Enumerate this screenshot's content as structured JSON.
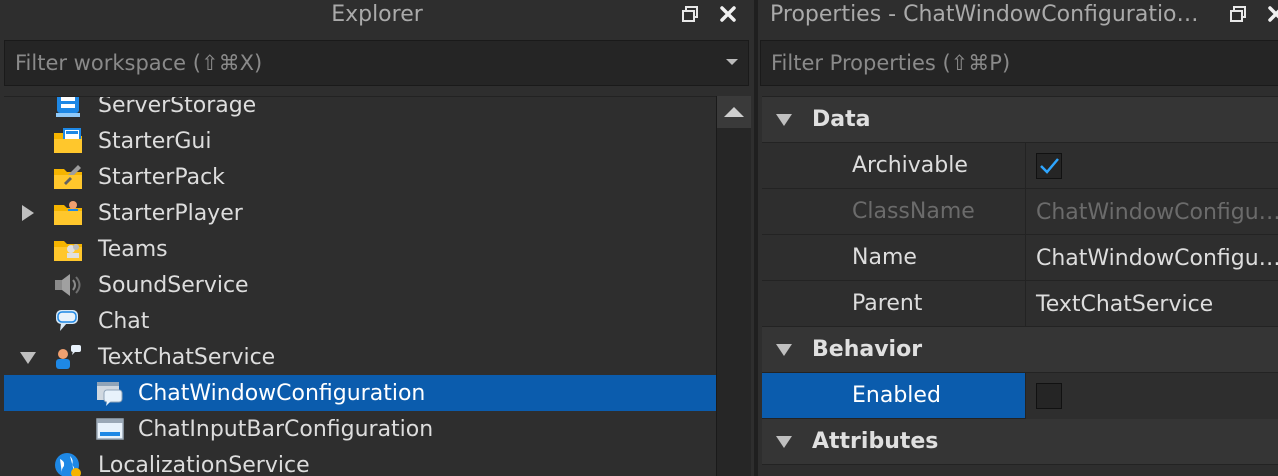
{
  "explorer": {
    "title": "Explorer",
    "filter_placeholder": "Filter workspace (⇧⌘X)",
    "items": [
      {
        "label": "ServerStorage",
        "icon": "server-storage-icon"
      },
      {
        "label": "StarterGui",
        "icon": "starter-gui-icon"
      },
      {
        "label": "StarterPack",
        "icon": "starter-pack-icon"
      },
      {
        "label": "StarterPlayer",
        "icon": "starter-player-icon"
      },
      {
        "label": "Teams",
        "icon": "teams-icon"
      },
      {
        "label": "SoundService",
        "icon": "speaker-icon"
      },
      {
        "label": "Chat",
        "icon": "chat-bubble-icon"
      },
      {
        "label": "TextChatService",
        "icon": "text-chat-service-icon"
      },
      {
        "label": "ChatWindowConfiguration",
        "icon": "chat-window-icon"
      },
      {
        "label": "ChatInputBarConfiguration",
        "icon": "input-bar-icon"
      },
      {
        "label": "LocalizationService",
        "icon": "globe-icon"
      }
    ]
  },
  "properties": {
    "title": "Properties - ChatWindowConfiguratio…",
    "filter_placeholder": "Filter Properties (⇧⌘P)",
    "sections": {
      "data": "Data",
      "behavior": "Behavior",
      "attributes": "Attributes"
    },
    "rows": {
      "archivable": {
        "name": "Archivable",
        "checked": true
      },
      "classname": {
        "name": "ClassName",
        "value": "ChatWindowConfigu…"
      },
      "name": {
        "name": "Name",
        "value": "ChatWindowConfigu…"
      },
      "parent": {
        "name": "Parent",
        "value": "TextChatService"
      },
      "enabled": {
        "name": "Enabled",
        "checked": false
      }
    }
  },
  "colors": {
    "selection": "#0b5cad",
    "panel_bg": "#2e2e2e",
    "checkmark": "#2ea6ff"
  }
}
